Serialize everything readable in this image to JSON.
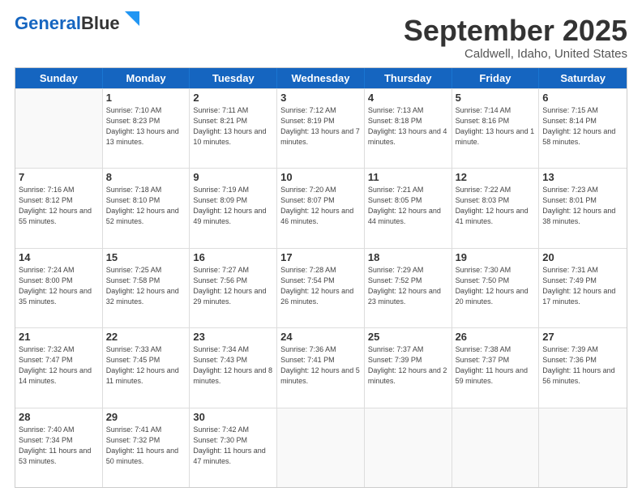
{
  "header": {
    "logo_line1": "General",
    "logo_line2": "Blue",
    "main_title": "September 2025",
    "subtitle": "Caldwell, Idaho, United States"
  },
  "calendar": {
    "days_of_week": [
      "Sunday",
      "Monday",
      "Tuesday",
      "Wednesday",
      "Thursday",
      "Friday",
      "Saturday"
    ],
    "rows": [
      [
        {
          "day": "",
          "sunrise": "",
          "sunset": "",
          "daylight": ""
        },
        {
          "day": "1",
          "sunrise": "Sunrise: 7:10 AM",
          "sunset": "Sunset: 8:23 PM",
          "daylight": "Daylight: 13 hours and 13 minutes."
        },
        {
          "day": "2",
          "sunrise": "Sunrise: 7:11 AM",
          "sunset": "Sunset: 8:21 PM",
          "daylight": "Daylight: 13 hours and 10 minutes."
        },
        {
          "day": "3",
          "sunrise": "Sunrise: 7:12 AM",
          "sunset": "Sunset: 8:19 PM",
          "daylight": "Daylight: 13 hours and 7 minutes."
        },
        {
          "day": "4",
          "sunrise": "Sunrise: 7:13 AM",
          "sunset": "Sunset: 8:18 PM",
          "daylight": "Daylight: 13 hours and 4 minutes."
        },
        {
          "day": "5",
          "sunrise": "Sunrise: 7:14 AM",
          "sunset": "Sunset: 8:16 PM",
          "daylight": "Daylight: 13 hours and 1 minute."
        },
        {
          "day": "6",
          "sunrise": "Sunrise: 7:15 AM",
          "sunset": "Sunset: 8:14 PM",
          "daylight": "Daylight: 12 hours and 58 minutes."
        }
      ],
      [
        {
          "day": "7",
          "sunrise": "Sunrise: 7:16 AM",
          "sunset": "Sunset: 8:12 PM",
          "daylight": "Daylight: 12 hours and 55 minutes."
        },
        {
          "day": "8",
          "sunrise": "Sunrise: 7:18 AM",
          "sunset": "Sunset: 8:10 PM",
          "daylight": "Daylight: 12 hours and 52 minutes."
        },
        {
          "day": "9",
          "sunrise": "Sunrise: 7:19 AM",
          "sunset": "Sunset: 8:09 PM",
          "daylight": "Daylight: 12 hours and 49 minutes."
        },
        {
          "day": "10",
          "sunrise": "Sunrise: 7:20 AM",
          "sunset": "Sunset: 8:07 PM",
          "daylight": "Daylight: 12 hours and 46 minutes."
        },
        {
          "day": "11",
          "sunrise": "Sunrise: 7:21 AM",
          "sunset": "Sunset: 8:05 PM",
          "daylight": "Daylight: 12 hours and 44 minutes."
        },
        {
          "day": "12",
          "sunrise": "Sunrise: 7:22 AM",
          "sunset": "Sunset: 8:03 PM",
          "daylight": "Daylight: 12 hours and 41 minutes."
        },
        {
          "day": "13",
          "sunrise": "Sunrise: 7:23 AM",
          "sunset": "Sunset: 8:01 PM",
          "daylight": "Daylight: 12 hours and 38 minutes."
        }
      ],
      [
        {
          "day": "14",
          "sunrise": "Sunrise: 7:24 AM",
          "sunset": "Sunset: 8:00 PM",
          "daylight": "Daylight: 12 hours and 35 minutes."
        },
        {
          "day": "15",
          "sunrise": "Sunrise: 7:25 AM",
          "sunset": "Sunset: 7:58 PM",
          "daylight": "Daylight: 12 hours and 32 minutes."
        },
        {
          "day": "16",
          "sunrise": "Sunrise: 7:27 AM",
          "sunset": "Sunset: 7:56 PM",
          "daylight": "Daylight: 12 hours and 29 minutes."
        },
        {
          "day": "17",
          "sunrise": "Sunrise: 7:28 AM",
          "sunset": "Sunset: 7:54 PM",
          "daylight": "Daylight: 12 hours and 26 minutes."
        },
        {
          "day": "18",
          "sunrise": "Sunrise: 7:29 AM",
          "sunset": "Sunset: 7:52 PM",
          "daylight": "Daylight: 12 hours and 23 minutes."
        },
        {
          "day": "19",
          "sunrise": "Sunrise: 7:30 AM",
          "sunset": "Sunset: 7:50 PM",
          "daylight": "Daylight: 12 hours and 20 minutes."
        },
        {
          "day": "20",
          "sunrise": "Sunrise: 7:31 AM",
          "sunset": "Sunset: 7:49 PM",
          "daylight": "Daylight: 12 hours and 17 minutes."
        }
      ],
      [
        {
          "day": "21",
          "sunrise": "Sunrise: 7:32 AM",
          "sunset": "Sunset: 7:47 PM",
          "daylight": "Daylight: 12 hours and 14 minutes."
        },
        {
          "day": "22",
          "sunrise": "Sunrise: 7:33 AM",
          "sunset": "Sunset: 7:45 PM",
          "daylight": "Daylight: 12 hours and 11 minutes."
        },
        {
          "day": "23",
          "sunrise": "Sunrise: 7:34 AM",
          "sunset": "Sunset: 7:43 PM",
          "daylight": "Daylight: 12 hours and 8 minutes."
        },
        {
          "day": "24",
          "sunrise": "Sunrise: 7:36 AM",
          "sunset": "Sunset: 7:41 PM",
          "daylight": "Daylight: 12 hours and 5 minutes."
        },
        {
          "day": "25",
          "sunrise": "Sunrise: 7:37 AM",
          "sunset": "Sunset: 7:39 PM",
          "daylight": "Daylight: 12 hours and 2 minutes."
        },
        {
          "day": "26",
          "sunrise": "Sunrise: 7:38 AM",
          "sunset": "Sunset: 7:37 PM",
          "daylight": "Daylight: 11 hours and 59 minutes."
        },
        {
          "day": "27",
          "sunrise": "Sunrise: 7:39 AM",
          "sunset": "Sunset: 7:36 PM",
          "daylight": "Daylight: 11 hours and 56 minutes."
        }
      ],
      [
        {
          "day": "28",
          "sunrise": "Sunrise: 7:40 AM",
          "sunset": "Sunset: 7:34 PM",
          "daylight": "Daylight: 11 hours and 53 minutes."
        },
        {
          "day": "29",
          "sunrise": "Sunrise: 7:41 AM",
          "sunset": "Sunset: 7:32 PM",
          "daylight": "Daylight: 11 hours and 50 minutes."
        },
        {
          "day": "30",
          "sunrise": "Sunrise: 7:42 AM",
          "sunset": "Sunset: 7:30 PM",
          "daylight": "Daylight: 11 hours and 47 minutes."
        },
        {
          "day": "",
          "sunrise": "",
          "sunset": "",
          "daylight": ""
        },
        {
          "day": "",
          "sunrise": "",
          "sunset": "",
          "daylight": ""
        },
        {
          "day": "",
          "sunrise": "",
          "sunset": "",
          "daylight": ""
        },
        {
          "day": "",
          "sunrise": "",
          "sunset": "",
          "daylight": ""
        }
      ]
    ]
  }
}
